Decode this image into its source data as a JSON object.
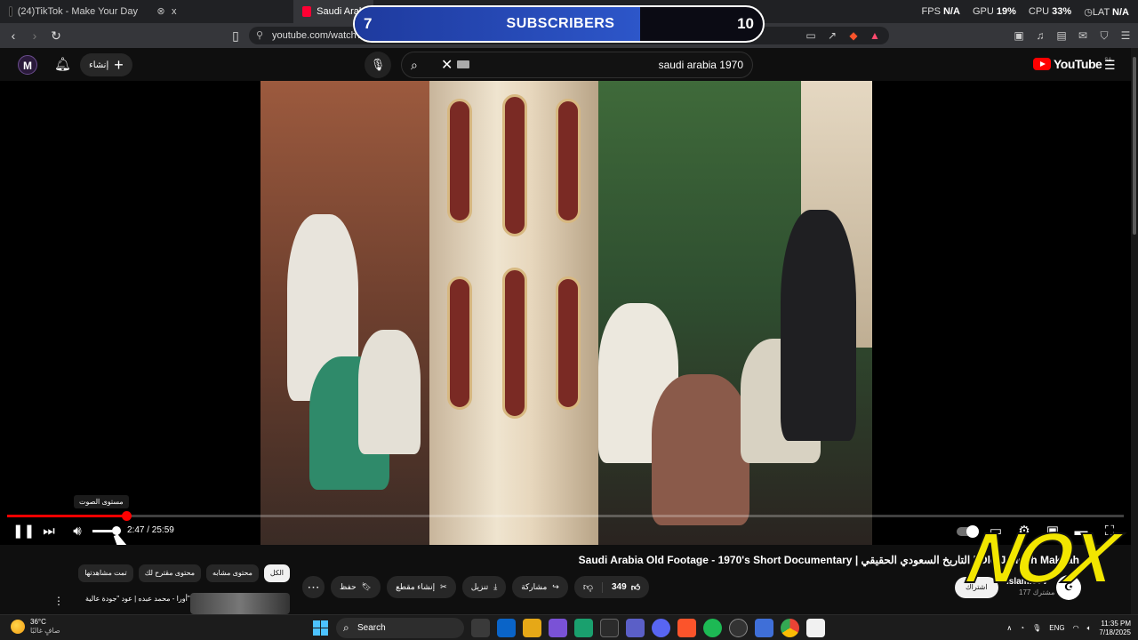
{
  "browser": {
    "tabs": [
      {
        "label": "(24)TikTok - Make Your Day",
        "icon": "tiktok-icon"
      },
      {
        "label": "x",
        "icon": "x-icon"
      },
      {
        "label": "Saudi Arab",
        "icon": "youtube-icon"
      }
    ],
    "stats": {
      "fps_label": "FPS",
      "fps_value": "N/A",
      "gpu_label": "GPU",
      "gpu_value": "19%",
      "cpu_label": "CPU",
      "cpu_value": "33%",
      "lat_label": "LAT",
      "lat_value": "N/A"
    },
    "url": "youtube.com/watch?v="
  },
  "subscriber_overlay": {
    "current": "7",
    "label": "SUBSCRIBERS",
    "goal": "10",
    "progress_fraction": 0.7,
    "fill_color": "#2d56c9"
  },
  "youtube_header": {
    "avatar_letter": "M",
    "create_label": "إنشاء",
    "search_query": "saudi arabia 1970",
    "logo_word": "YouTube",
    "region": "SA"
  },
  "player": {
    "hover_tooltip": "مستوى الصوت",
    "current_time": "2:47",
    "duration": "25:59",
    "time_display": "2:47 / 25:59",
    "progress_fraction": 0.107,
    "volume_fraction": 1.0,
    "progress_color": "#ff0000"
  },
  "video_info": {
    "title": "Saudi Arabia Old Footage - 1970's Short Documentary | التاريخ السعودي الحقيقي | Old Jeddah Makkah",
    "channel_name": "IslamicTV",
    "channel_subs": "177 مشترك",
    "subscribe_label": "اشتراك",
    "like_count": "349",
    "actions": {
      "share": "مشاركة",
      "download": "تنزيل",
      "clip": "إنشاء مقطع",
      "save": "حفظ"
    }
  },
  "chips": [
    "الكل",
    "محتوى مشابه",
    "محتوى مقترح لك",
    "تمت مشاهدتها"
  ],
  "recommendation": {
    "title": "أورا - محمد عبده | عود \"جودة عالية\""
  },
  "watermark": "NOX",
  "taskbar": {
    "temperature": "36°C",
    "weather_condition": "صافٍ غالبًا",
    "search_label": "Search",
    "language": "ENG",
    "time": "11:35 PM",
    "date": "7/18/2025"
  }
}
